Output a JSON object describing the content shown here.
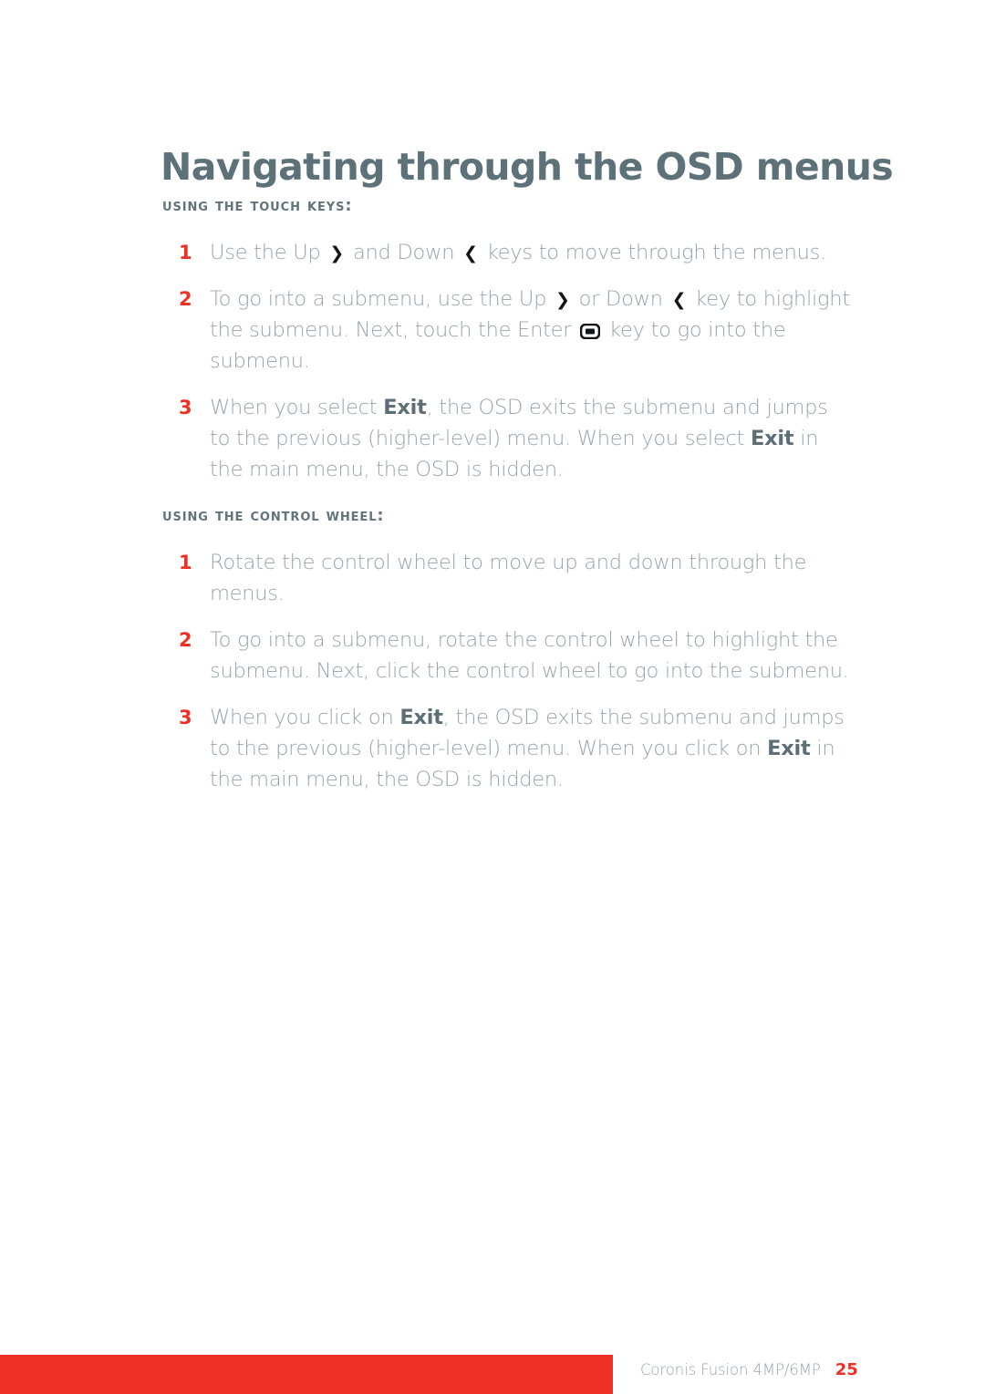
{
  "document": {
    "title": "Navigating through the OSD menus",
    "sections": [
      {
        "heading": "Using the touch keys:",
        "steps": [
          {
            "num": "1",
            "parts": [
              {
                "t": "text",
                "v": "Use the Up "
              },
              {
                "t": "icon",
                "v": "chevron-right-icon"
              },
              {
                "t": "text",
                "v": " and Down "
              },
              {
                "t": "icon",
                "v": "chevron-left-icon"
              },
              {
                "t": "text",
                "v": " keys to move through the menus."
              }
            ],
            "plain": "Use the Up > and Down < keys to move through the menus."
          },
          {
            "num": "2",
            "parts": [
              {
                "t": "text",
                "v": "To go into a submenu, use the Up "
              },
              {
                "t": "icon",
                "v": "chevron-right-icon"
              },
              {
                "t": "text",
                "v": " or Down "
              },
              {
                "t": "icon",
                "v": "chevron-left-icon"
              },
              {
                "t": "text",
                "v": " key to highlight the submenu. Next, touch the Enter "
              },
              {
                "t": "icon",
                "v": "enter-key-icon"
              },
              {
                "t": "text",
                "v": " key to go into the submenu."
              }
            ],
            "plain": "To go into a submenu, use the Up > or Down < key to highlight the submenu. Next, touch the Enter key to go into the submenu."
          },
          {
            "num": "3",
            "parts": [
              {
                "t": "text",
                "v": "When you select "
              },
              {
                "t": "bold",
                "v": "Exit"
              },
              {
                "t": "text",
                "v": ", the OSD exits the submenu and jumps to the previous (higher-level) menu. When you select "
              },
              {
                "t": "bold",
                "v": "Exit"
              },
              {
                "t": "text",
                "v": " in the main menu, the OSD is hidden."
              }
            ],
            "plain": "When you select Exit, the OSD exits the submenu and jumps to the previous (higher-level) menu. When you select Exit in the main menu, the OSD is hidden."
          }
        ]
      },
      {
        "heading": "Using the control wheel:",
        "steps": [
          {
            "num": "1",
            "parts": [
              {
                "t": "text",
                "v": "Rotate the control wheel to move up and down through the menus."
              }
            ],
            "plain": "Rotate the control wheel to move up and down through the menus."
          },
          {
            "num": "2",
            "parts": [
              {
                "t": "text",
                "v": "To go into a submenu, rotate the control wheel to highlight the submenu. Next, click the control wheel to go into the submenu."
              }
            ],
            "plain": "To go into a submenu, rotate the control wheel to highlight the submenu. Next, click the control wheel to go into the submenu."
          },
          {
            "num": "3",
            "parts": [
              {
                "t": "text",
                "v": "When you click on "
              },
              {
                "t": "bold",
                "v": "Exit"
              },
              {
                "t": "text",
                "v": ", the OSD exits the submenu and jumps to the previous (higher-level) menu. When you click on "
              },
              {
                "t": "bold",
                "v": "Exit"
              },
              {
                "t": "text",
                "v": " in the main menu, the OSD is hidden."
              }
            ],
            "plain": "When you click on Exit, the OSD exits the submenu and jumps to the previous (higher-level) menu. When you click on Exit in the main menu, the OSD is hidden."
          }
        ]
      }
    ]
  },
  "footer": {
    "product": "Coronis Fusion 4MP/6MP",
    "page_number": "25"
  },
  "colors": {
    "title": "#5d7179",
    "heading": "#61747c",
    "body": "#96a4ac",
    "bold_emphasis": "#5d6e77",
    "accent_red": "#ee3124",
    "background": "#ffffff"
  },
  "icons": {
    "chevron-right-icon": "❯",
    "chevron-left-icon": "❮",
    "enter-key-icon": "enter-key"
  }
}
